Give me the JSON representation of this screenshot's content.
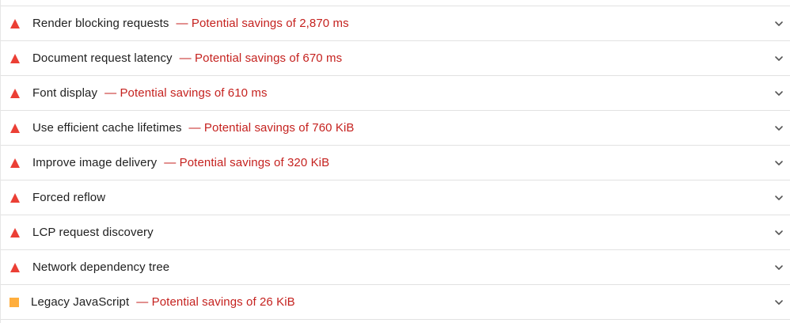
{
  "colors": {
    "fail": "#eb3f35",
    "average": "#ffae3d",
    "savings_text": "#c5221f",
    "title_text": "#212121",
    "divider": "#e2e2e2"
  },
  "audits": [
    {
      "title": "Render blocking requests",
      "savings": "— Potential savings of 2,870 ms",
      "status": "fail",
      "icon": "red-triangle-icon"
    },
    {
      "title": "Document request latency",
      "savings": "— Potential savings of 670 ms",
      "status": "fail",
      "icon": "red-triangle-icon"
    },
    {
      "title": "Font display",
      "savings": "— Potential savings of 610 ms",
      "status": "fail",
      "icon": "red-triangle-icon"
    },
    {
      "title": "Use efficient cache lifetimes",
      "savings": "— Potential savings of 760 KiB",
      "status": "fail",
      "icon": "red-triangle-icon"
    },
    {
      "title": "Improve image delivery",
      "savings": "— Potential savings of 320 KiB",
      "status": "fail",
      "icon": "red-triangle-icon"
    },
    {
      "title": "Forced reflow",
      "savings": "",
      "status": "fail",
      "icon": "red-triangle-icon"
    },
    {
      "title": "LCP request discovery",
      "savings": "",
      "status": "fail",
      "icon": "red-triangle-icon"
    },
    {
      "title": "Network dependency tree",
      "savings": "",
      "status": "fail",
      "icon": "red-triangle-icon"
    },
    {
      "title": "Legacy JavaScript",
      "savings": "— Potential savings of 26 KiB",
      "status": "average",
      "icon": "orange-square-icon"
    }
  ]
}
